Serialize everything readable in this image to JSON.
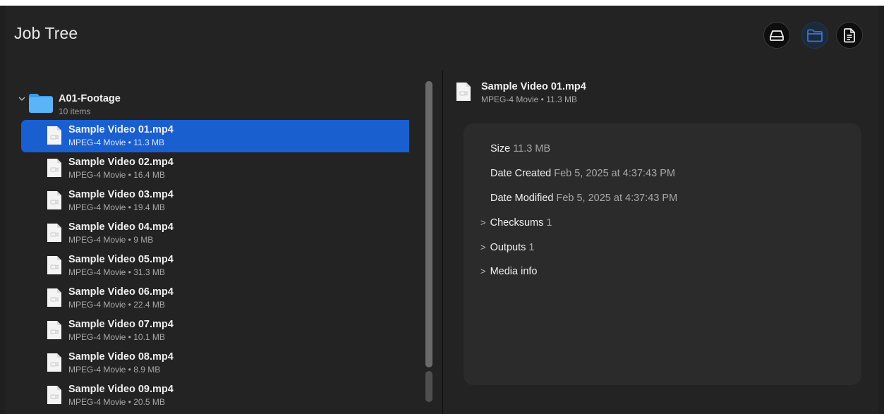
{
  "window": {
    "title": "Job Tree"
  },
  "toolbar": {
    "buttons": [
      {
        "icon": "drive-icon",
        "active": false
      },
      {
        "icon": "folder-icon",
        "active": true
      },
      {
        "icon": "document-icon",
        "active": false
      }
    ]
  },
  "tree": {
    "folder": {
      "name": "A01-Footage",
      "count_label": "10 items",
      "expanded": true
    },
    "files": [
      {
        "name": "Sample Video 01.mp4",
        "meta": "MPEG-4 Movie • 11.3 MB",
        "selected": true
      },
      {
        "name": "Sample Video 02.mp4",
        "meta": "MPEG-4 Movie • 16.4 MB"
      },
      {
        "name": "Sample Video 03.mp4",
        "meta": "MPEG-4 Movie • 19.4 MB"
      },
      {
        "name": "Sample Video 04.mp4",
        "meta": "MPEG-4 Movie • 9 MB"
      },
      {
        "name": "Sample Video 05.mp4",
        "meta": "MPEG-4 Movie • 31.3 MB"
      },
      {
        "name": "Sample Video 06.mp4",
        "meta": "MPEG-4 Movie • 22.4 MB"
      },
      {
        "name": "Sample Video 07.mp4",
        "meta": "MPEG-4 Movie • 10.1 MB"
      },
      {
        "name": "Sample Video 08.mp4",
        "meta": "MPEG-4 Movie • 8.9 MB"
      },
      {
        "name": "Sample Video 09.mp4",
        "meta": "MPEG-4 Movie • 20.5 MB"
      }
    ]
  },
  "detail": {
    "name": "Sample Video 01.mp4",
    "meta": "MPEG-4 Movie • 11.3 MB",
    "size_label": "Size",
    "size_value": "11.3 MB",
    "created_label": "Date Created",
    "created_value": "Feb 5, 2025 at 4:37:43 PM",
    "modified_label": "Date Modified",
    "modified_value": "Feb 5, 2025 at 4:37:43 PM",
    "sections": [
      {
        "label": "Checksums",
        "count": "1"
      },
      {
        "label": "Outputs",
        "count": "1"
      },
      {
        "label": "Media info",
        "count": ""
      }
    ]
  },
  "colors": {
    "selection": "#1a5fd0",
    "background": "#232323",
    "card": "#2b2b2b"
  }
}
